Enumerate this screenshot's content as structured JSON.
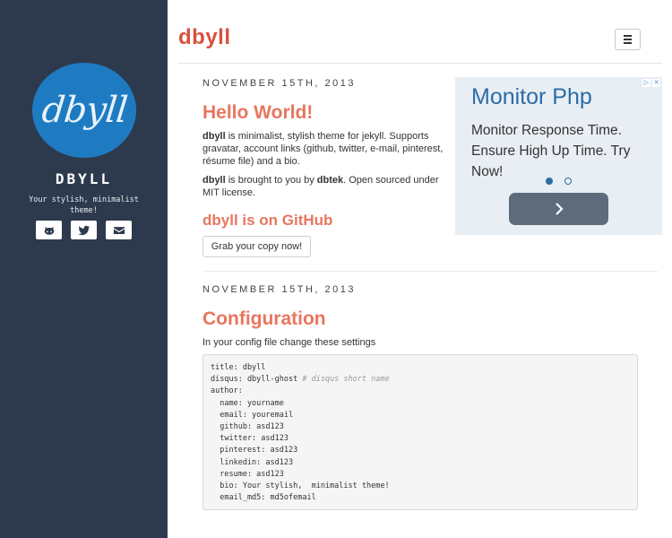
{
  "sidebar": {
    "avatar_text": "dbyll",
    "site_name": "DBYLL",
    "bio": "Your stylish, minimalist theme!",
    "social": [
      {
        "name": "github-icon",
        "label": "GitHub"
      },
      {
        "name": "twitter-icon",
        "label": "Twitter"
      },
      {
        "name": "email-icon",
        "label": "E-mail"
      }
    ]
  },
  "header": {
    "brand": "dbyll",
    "menu_icon": "menu-icon"
  },
  "posts": [
    {
      "date": "NOVEMBER 15TH, 2013",
      "title": "Hello World!",
      "para1_strong": "dbyll",
      "para1_rest": " is minimalist, stylish theme for jekyll. Supports gravatar, account links (github, twitter, e-mail, pinterest, résume file) and a bio.",
      "para2_strong1": "dbyll",
      "para2_mid": " is brought to you by ",
      "para2_strong2": "dbtek",
      "para2_rest": ". Open sourced under MIT license.",
      "subtitle": "dbyll is on GitHub",
      "button": "Grab your copy now!"
    },
    {
      "date": "NOVEMBER 15TH, 2013",
      "title": "Configuration",
      "intro": "In your config file change these settings",
      "code_lines": [
        {
          "text": "title: dbyll",
          "comment": ""
        },
        {
          "text": "disqus: dbyll-ghost ",
          "comment": "# disqus short name"
        },
        {
          "text": "author:",
          "comment": ""
        },
        {
          "text": "  name: yourname",
          "comment": ""
        },
        {
          "text": "  email: youremail",
          "comment": ""
        },
        {
          "text": "  github: asd123",
          "comment": ""
        },
        {
          "text": "  twitter: asd123",
          "comment": ""
        },
        {
          "text": "  pinterest: asd123",
          "comment": ""
        },
        {
          "text": "  linkedin: asd123",
          "comment": ""
        },
        {
          "text": "  resume: asd123",
          "comment": ""
        },
        {
          "text": "  bio: Your stylish,  minimalist theme!",
          "comment": ""
        },
        {
          "text": "  email_md5: md5ofemail",
          "comment": ""
        }
      ]
    }
  ],
  "ad": {
    "title": "Monitor Php",
    "text": "Monitor Response Time. Ensure High Up Time. Try Now!",
    "badge": [
      "▷",
      "✕"
    ],
    "active_slide": 1,
    "slide_count": 2,
    "colors": {
      "title": "#2c6ca8",
      "button": "#5d6b7b",
      "background": "#e8eef4"
    }
  },
  "colors": {
    "sidebar": "#2d3a4e",
    "avatar": "#1e7bc2",
    "brand": "#d9513c",
    "post_title": "#e8765e"
  }
}
